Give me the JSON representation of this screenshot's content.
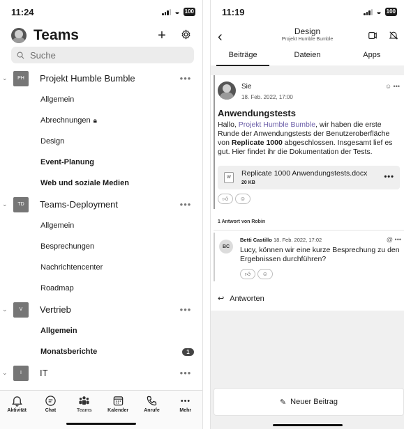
{
  "left": {
    "status": {
      "time": "11:24",
      "battery": "100"
    },
    "header": {
      "title": "Teams",
      "add_icon": "plus-icon",
      "settings_icon": "gear-icon"
    },
    "search": {
      "placeholder": "Suche"
    },
    "teams": [
      {
        "initials": "PH",
        "name": "Projekt Humble Bumble",
        "channels": [
          {
            "label": "Allgemein",
            "bold": false
          },
          {
            "label": "Abrechnungen",
            "bold": false,
            "locked": true
          },
          {
            "label": "Design",
            "bold": false
          },
          {
            "label": "Event-Planung",
            "bold": true
          },
          {
            "label": "Web und soziale Medien",
            "bold": true
          }
        ]
      },
      {
        "initials": "TD",
        "name": "Teams-Deployment",
        "channels": [
          {
            "label": "Allgemein",
            "bold": false
          },
          {
            "label": "Besprechungen",
            "bold": false
          },
          {
            "label": "Nachrichtencenter",
            "bold": false
          },
          {
            "label": "Roadmap",
            "bold": false
          }
        ]
      },
      {
        "initials": "V",
        "name": "Vertrieb",
        "channels": [
          {
            "label": "Allgemein",
            "bold": true
          },
          {
            "label": "Monatsberichte",
            "bold": true,
            "badge": "1"
          }
        ]
      },
      {
        "initials": "I",
        "name": "IT",
        "channels": []
      }
    ],
    "tabbar": [
      {
        "label": "Aktivität",
        "icon": "bell-icon"
      },
      {
        "label": "Chat",
        "icon": "chat-icon"
      },
      {
        "label": "Teams",
        "icon": "teams-icon",
        "active": true
      },
      {
        "label": "Kalender",
        "icon": "calendar-icon"
      },
      {
        "label": "Anrufe",
        "icon": "phone-icon"
      },
      {
        "label": "Mehr",
        "icon": "more-icon"
      }
    ]
  },
  "right": {
    "status": {
      "time": "11:19",
      "battery": "100"
    },
    "channel": {
      "title": "Design",
      "subtitle": "Projekt Humble Bumble"
    },
    "tabs": [
      "Beiträge",
      "Dateien",
      "Apps"
    ],
    "post": {
      "author": "Sie",
      "date": "18. Feb. 2022, 17:00",
      "subject": "Anwendungstests",
      "body_parts": {
        "p1": "Hallo, ",
        "mention": "Projekt Humble Bumble",
        "p2": ", wir haben die erste Runde der Anwendungstests der Benutzeroberfläche von ",
        "bold": "Replicate 1000",
        "p3": " abgeschlossen. Insgesamt lief es gut. Hier findet ihr die Dokumentation der Tests."
      },
      "attachment": {
        "name": "Replicate 1000 Anwendungstests.docx",
        "size": "20 KB"
      },
      "reply_count": "1 Antwort von Robin"
    },
    "reply": {
      "initials": "BC",
      "author": "Betti Castillo",
      "date": "18. Feb. 2022, 17:02",
      "body": "Lucy, können wir eine kurze Besprechung zu den Ergebnissen durchführen?"
    },
    "answer_label": "Antworten",
    "new_post_label": "Neuer Beitrag"
  }
}
